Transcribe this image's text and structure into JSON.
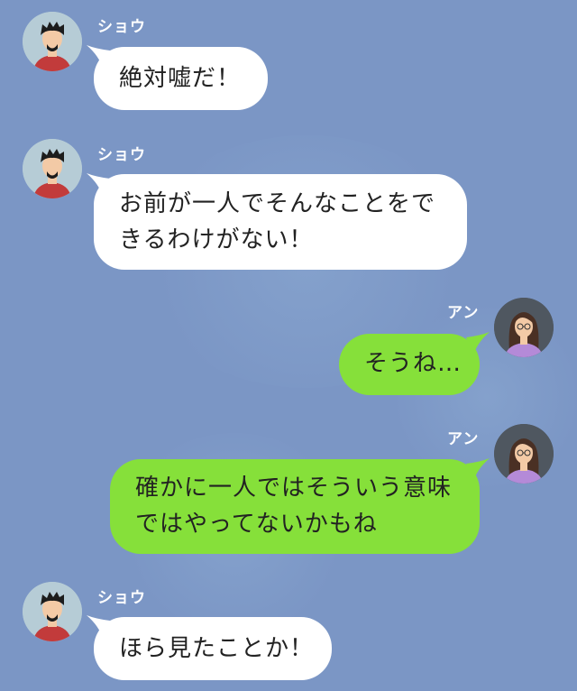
{
  "chat": {
    "messages": [
      {
        "sender": "ショウ",
        "side": "left",
        "lines": [
          "絶対嘘だ！"
        ]
      },
      {
        "sender": "ショウ",
        "side": "left",
        "lines": [
          "お前が一人でそんなことをで",
          "きるわけがない！"
        ]
      },
      {
        "sender": "アン",
        "side": "right",
        "lines": [
          "そうね…"
        ]
      },
      {
        "sender": "アン",
        "side": "right",
        "lines": [
          "確かに一人ではそういう意味",
          "ではやってないかもね"
        ]
      },
      {
        "sender": "ショウ",
        "side": "left",
        "lines": [
          "ほら見たことか！"
        ]
      }
    ]
  },
  "colors": {
    "background": "#7b96c5",
    "incoming_bubble": "#ffffff",
    "outgoing_bubble": "#86e03a"
  },
  "icons": {
    "male_avatar": "male-avatar-icon",
    "female_avatar": "female-avatar-icon"
  }
}
